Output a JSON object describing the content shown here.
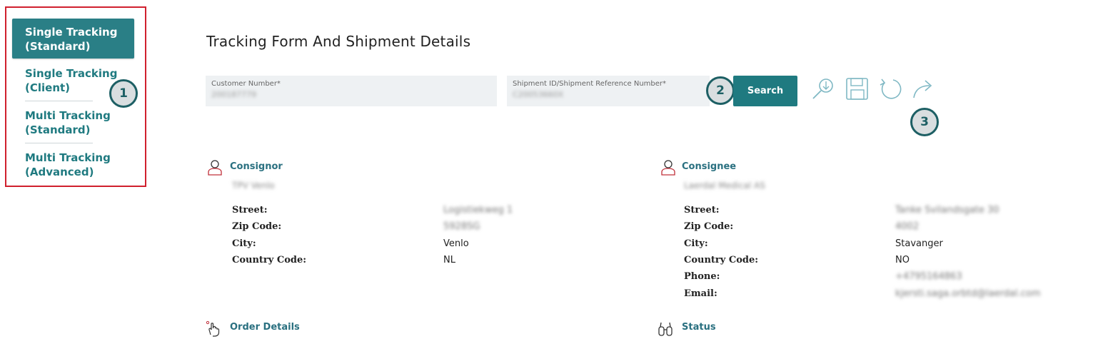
{
  "sidebar": {
    "items": [
      {
        "line1": "Single Tracking",
        "line2": "(Standard)",
        "active": true
      },
      {
        "line1": "Single Tracking",
        "line2": "(Client)",
        "active": false
      },
      {
        "line1": "Multi Tracking",
        "line2": "(Standard)",
        "active": false
      },
      {
        "line1": "Multi Tracking",
        "line2": "(Advanced)",
        "active": false
      }
    ]
  },
  "badges": {
    "b1": "1",
    "b2": "2",
    "b3": "3"
  },
  "main": {
    "title": "Tracking Form And Shipment Details",
    "customer_number": {
      "label": "Customer Number*",
      "value": "200187779"
    },
    "shipment_id": {
      "label": "Shipment ID/Shipment Reference Number*",
      "value": "C20053660X"
    },
    "search_label": "Search"
  },
  "toolbar": {
    "icons": [
      "zoom-download-icon",
      "save-icon",
      "refresh-icon",
      "forward-icon"
    ],
    "color": "#7fb8c4"
  },
  "consignor": {
    "title": "Consignor",
    "name": "TPV Venlo",
    "rows": [
      {
        "label": "Street:",
        "value": "Logistiekweg 1",
        "blurred": true
      },
      {
        "label": "Zip Code:",
        "value": "5928SG",
        "blurred": true
      },
      {
        "label": "City:",
        "value": "Venlo",
        "blurred": false
      },
      {
        "label": "Country Code:",
        "value": "NL",
        "blurred": false
      }
    ]
  },
  "consignee": {
    "title": "Consignee",
    "name": "Laerdal Medical AS",
    "rows": [
      {
        "label": "Street:",
        "value": "Tanke Svilandsgate 30",
        "blurred": true
      },
      {
        "label": "Zip Code:",
        "value": "4002",
        "blurred": true
      },
      {
        "label": "City:",
        "value": "Stavanger",
        "blurred": false
      },
      {
        "label": "Country Code:",
        "value": "NO",
        "blurred": false
      },
      {
        "label": "Phone:",
        "value": "+4795164863",
        "blurred": true
      },
      {
        "label": "Email:",
        "value": "kjersti.saga.orbtd@laerdal.com",
        "blurred": true
      }
    ]
  },
  "order_details": {
    "title": "Order Details"
  },
  "status": {
    "title": "Status"
  },
  "colors": {
    "accent": "#1f7a80",
    "highlight_border": "#d0202e"
  }
}
